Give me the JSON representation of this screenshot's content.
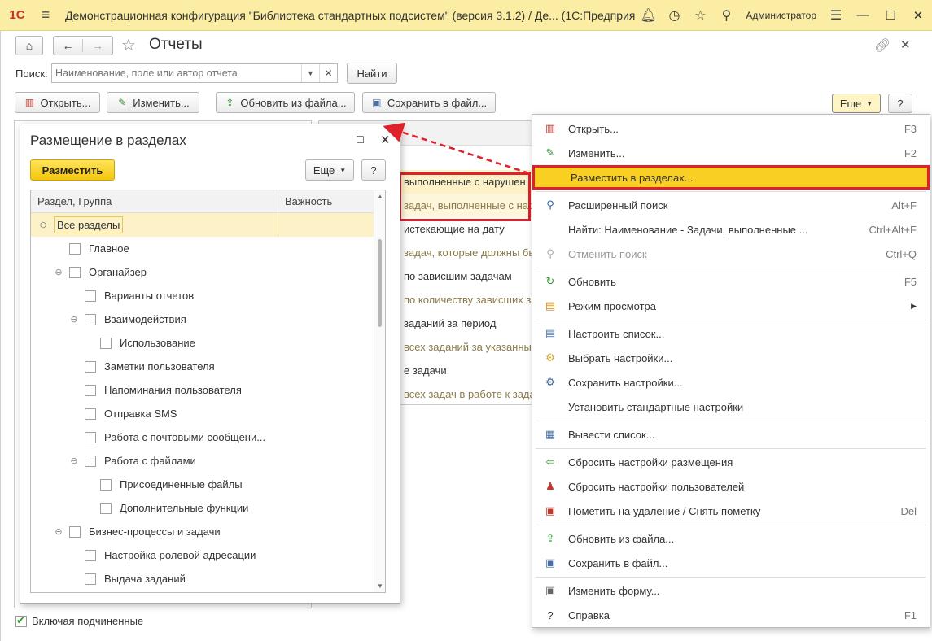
{
  "app": {
    "logo": "1С",
    "title": "Демонстрационная конфигурация \"Библиотека стандартных подсистем\" (версия 3.1.2) / Де...  (1С:Предприятие)",
    "user": "Администратор"
  },
  "form": {
    "title": "Отчеты",
    "search_label": "Поиск:",
    "search_placeholder": "Наименование, поле или автор отчета",
    "find_button": "Найти",
    "toolbar": {
      "open": "Открыть...",
      "edit": "Изменить...",
      "update_from_file": "Обновить из файла...",
      "save_to_file": "Сохранить в файл...",
      "more": "Еще",
      "help": "?"
    },
    "include_subordinate": "Включая подчиненные"
  },
  "background_list": [
    {
      "text": "выполненные с нарушен",
      "type": "main",
      "state": "sel"
    },
    {
      "text": "задач, выполненные с нар",
      "type": "sub",
      "state": "sel2"
    },
    {
      "text": "истекающие на дату",
      "type": "main",
      "state": ""
    },
    {
      "text": "задач, которые должны бы",
      "type": "sub",
      "state": ""
    },
    {
      "text": "по зависшим задачам",
      "type": "main",
      "state": ""
    },
    {
      "text": "по количеству зависших за",
      "type": "sub",
      "state": ""
    },
    {
      "text": "заданий за период",
      "type": "main",
      "state": ""
    },
    {
      "text": "всех заданий за указанный",
      "type": "sub",
      "state": ""
    },
    {
      "text": "е задачи",
      "type": "main",
      "state": ""
    },
    {
      "text": "всех задач в работе к зада",
      "type": "sub",
      "state": ""
    }
  ],
  "popup": {
    "title": "Размещение в разделах",
    "place_button": "Разместить",
    "more": "Еще",
    "help": "?",
    "col_section": "Раздел, Группа",
    "col_importance": "Важность",
    "tree": [
      {
        "label": "Все разделы",
        "level": 0,
        "expander": "⊖",
        "checkbox": false,
        "selected": true
      },
      {
        "label": "Главное",
        "level": 1,
        "expander": "",
        "checkbox": true,
        "selected": false
      },
      {
        "label": "Органайзер",
        "level": 1,
        "expander": "⊖",
        "checkbox": true,
        "selected": false
      },
      {
        "label": "Варианты отчетов",
        "level": 2,
        "expander": "",
        "checkbox": true,
        "selected": false
      },
      {
        "label": "Взаимодействия",
        "level": 2,
        "expander": "⊖",
        "checkbox": true,
        "selected": false
      },
      {
        "label": "Использование",
        "level": 3,
        "expander": "",
        "checkbox": true,
        "selected": false
      },
      {
        "label": "Заметки пользователя",
        "level": 2,
        "expander": "",
        "checkbox": true,
        "selected": false
      },
      {
        "label": "Напоминания пользователя",
        "level": 2,
        "expander": "",
        "checkbox": true,
        "selected": false
      },
      {
        "label": "Отправка SMS",
        "level": 2,
        "expander": "",
        "checkbox": true,
        "selected": false
      },
      {
        "label": "Работа с почтовыми сообщени...",
        "level": 2,
        "expander": "",
        "checkbox": true,
        "selected": false
      },
      {
        "label": "Работа с файлами",
        "level": 2,
        "expander": "⊖",
        "checkbox": true,
        "selected": false
      },
      {
        "label": "Присоединенные файлы",
        "level": 3,
        "expander": "",
        "checkbox": true,
        "selected": false
      },
      {
        "label": "Дополнительные функции",
        "level": 3,
        "expander": "",
        "checkbox": true,
        "selected": false
      },
      {
        "label": "Бизнес-процессы и задачи",
        "level": 1,
        "expander": "⊖",
        "checkbox": true,
        "selected": false
      },
      {
        "label": "Настройка ролевой адресации",
        "level": 2,
        "expander": "",
        "checkbox": true,
        "selected": false
      },
      {
        "label": "Выдача заданий",
        "level": 2,
        "expander": "",
        "checkbox": true,
        "selected": false
      }
    ]
  },
  "menu": {
    "groups": [
      [
        {
          "label": "Открыть...",
          "key": "F3",
          "icon": "report-icon",
          "glyph": "▥",
          "color": "#c0392b"
        },
        {
          "label": "Изменить...",
          "key": "F2",
          "icon": "pencil-icon",
          "glyph": "✎",
          "color": "#2e8b2e"
        },
        {
          "label": "Разместить в разделах...",
          "key": "",
          "icon": "",
          "glyph": "",
          "color": "",
          "highlight": true
        }
      ],
      [
        {
          "label": "Расширенный поиск",
          "key": "Alt+F",
          "icon": "search-icon",
          "glyph": "⚲",
          "color": "#2a6bb5"
        },
        {
          "label": "Найти: Наименование - Задачи, выполненные ...",
          "key": "Ctrl+Alt+F",
          "icon": "",
          "glyph": "",
          "color": ""
        },
        {
          "label": "Отменить поиск",
          "key": "Ctrl+Q",
          "icon": "cancel-search-icon",
          "glyph": "⚲",
          "color": "#aaaaaa",
          "disabled": true
        }
      ],
      [
        {
          "label": "Обновить",
          "key": "F5",
          "icon": "refresh-icon",
          "glyph": "↻",
          "color": "#2e9b2e"
        },
        {
          "label": "Режим просмотра",
          "key": "",
          "icon": "view-mode-icon",
          "glyph": "▤",
          "color": "#d08a1a",
          "submenu": "▶"
        }
      ],
      [
        {
          "label": "Настроить список...",
          "key": "",
          "icon": "list-settings-icon",
          "glyph": "▤",
          "color": "#4a6fa5"
        },
        {
          "label": "Выбрать настройки...",
          "key": "",
          "icon": "choose-settings-icon",
          "glyph": "⚙",
          "color": "#c9a227"
        },
        {
          "label": "Сохранить настройки...",
          "key": "",
          "icon": "save-settings-icon",
          "glyph": "⚙",
          "color": "#4a6fa5"
        },
        {
          "label": "Установить стандартные настройки",
          "key": "",
          "icon": "",
          "glyph": "",
          "color": ""
        }
      ],
      [
        {
          "label": "Вывести список...",
          "key": "",
          "icon": "print-list-icon",
          "glyph": "▦",
          "color": "#4a6fa5"
        }
      ],
      [
        {
          "label": "Сбросить настройки размещения",
          "key": "",
          "icon": "reset-placement-icon",
          "glyph": "⇦",
          "color": "#2e9b2e"
        },
        {
          "label": "Сбросить настройки пользователей",
          "key": "",
          "icon": "reset-users-icon",
          "glyph": "♟",
          "color": "#c0392b"
        },
        {
          "label": "Пометить на удаление / Снять пометку",
          "key": "Del",
          "icon": "delete-mark-icon",
          "glyph": "▣",
          "color": "#c0392b"
        }
      ],
      [
        {
          "label": "Обновить из файла...",
          "key": "",
          "icon": "update-from-file-icon",
          "glyph": "⇪",
          "color": "#2e9b2e"
        },
        {
          "label": "Сохранить в файл...",
          "key": "",
          "icon": "save-to-file-icon",
          "glyph": "▣",
          "color": "#4a6fa5"
        }
      ],
      [
        {
          "label": "Изменить форму...",
          "key": "",
          "icon": "edit-form-icon",
          "glyph": "▣",
          "color": "#666666"
        },
        {
          "label": "Справка",
          "key": "F1",
          "icon": "help-icon",
          "glyph": "?",
          "color": "#333333"
        }
      ]
    ]
  },
  "colors": {
    "appbar": "#fbeda4",
    "accent_yellow": "#f9cf23",
    "highlight_red": "#e0212b",
    "selection": "#fcf1c7"
  }
}
